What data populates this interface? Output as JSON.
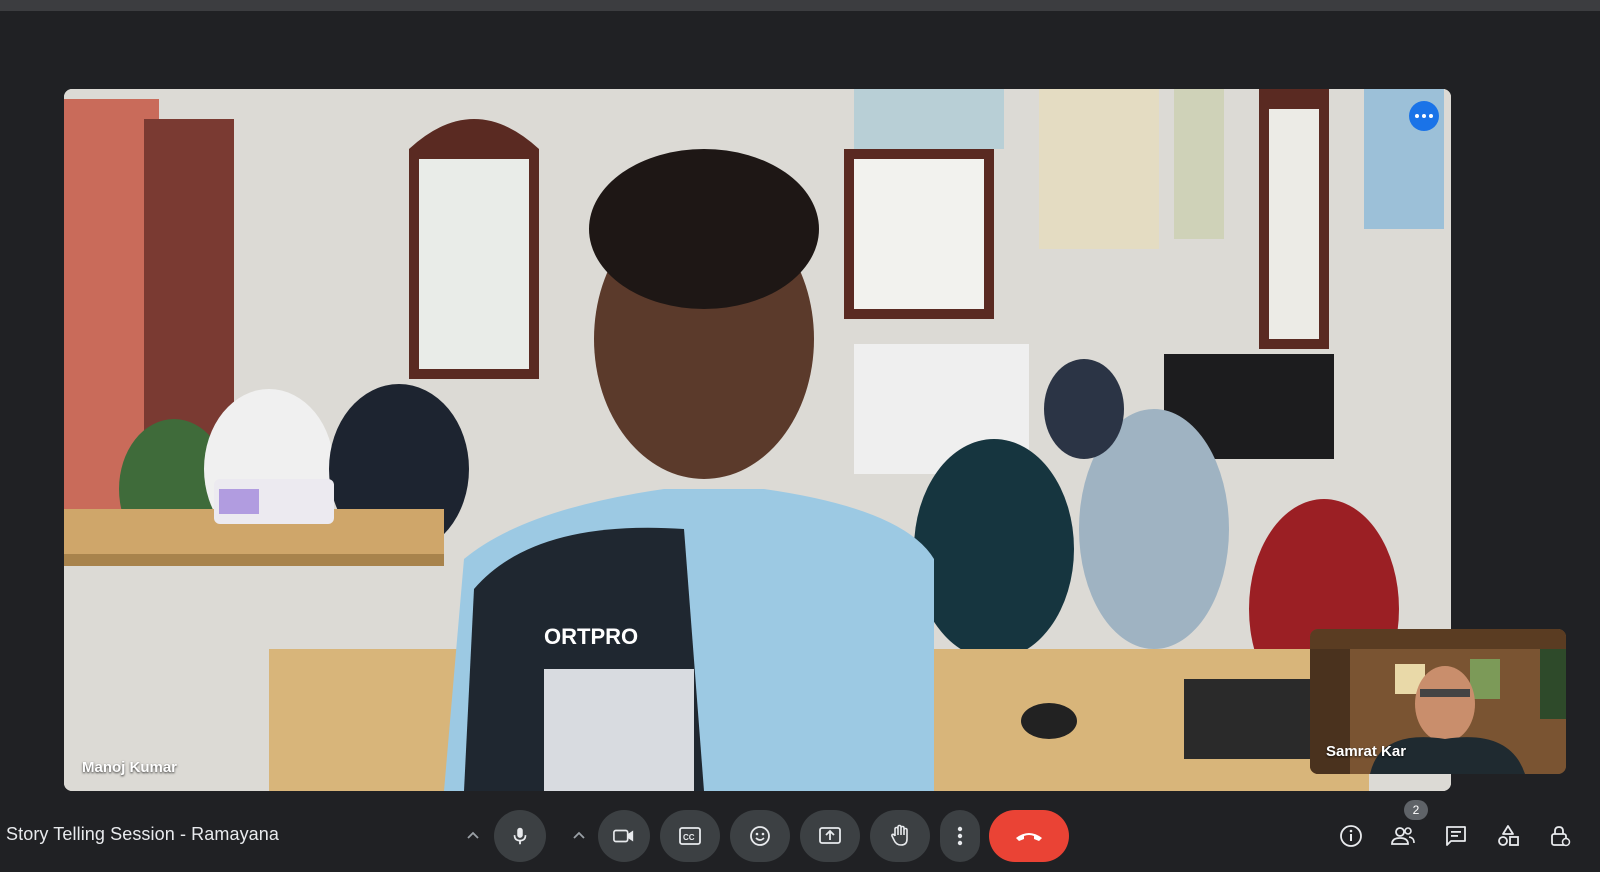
{
  "meeting": {
    "title": "Story Telling Session - Ramayana"
  },
  "participants": {
    "main": {
      "name": "Manoj Kumar"
    },
    "self": {
      "name": "Samrat Kar"
    },
    "count": "2"
  },
  "controls": {
    "mic_icon": "microphone-icon",
    "camera_icon": "video-camera-icon",
    "captions_icon": "closed-captions-icon",
    "reactions_icon": "emoji-icon",
    "present_icon": "present-screen-icon",
    "hand_icon": "raise-hand-icon",
    "more_icon": "more-vert-icon",
    "hangup_icon": "end-call-icon"
  },
  "side_panel": {
    "icons": [
      "info-icon",
      "people-icon",
      "chat-icon",
      "activities-icon",
      "host-controls-icon"
    ]
  },
  "colors": {
    "background": "#202124",
    "control_bg": "#3c4043",
    "hangup": "#ea4335",
    "accent": "#1a73e8"
  }
}
